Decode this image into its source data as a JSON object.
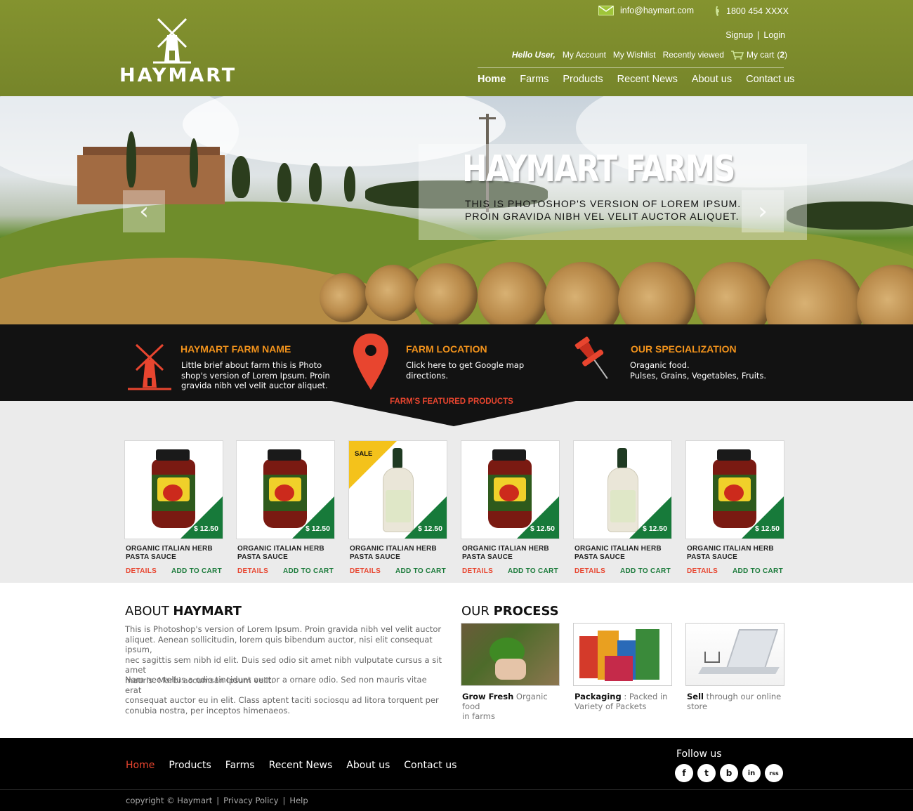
{
  "brand": {
    "name": "HAYMART"
  },
  "contact": {
    "email": "info@haymart.com",
    "phone": "1800 454 XXXX"
  },
  "auth": {
    "signup": "Signup",
    "separator": "|",
    "login": "Login"
  },
  "userbar": {
    "hello": "Hello User,",
    "my_account": "My Account",
    "my_wishlist": "My Wishlist",
    "recently_viewed": "Recently viewed",
    "cart_label": "My cart",
    "cart_count": "2"
  },
  "nav": [
    "Home",
    "Farms",
    "Products",
    "Recent News",
    "About us",
    "Contact us"
  ],
  "hero": {
    "title": "HAYMART FARMS",
    "subtitle_line1": "THIS IS PHOTOSHOP'S VERSION  OF LOREM IPSUM.",
    "subtitle_line2": "PROIN GRAVIDA NIBH VEL VELIT AUCTOR ALIQUET.",
    "prev": "‹",
    "next": "›"
  },
  "features": [
    {
      "title": "HAYMART FARM NAME",
      "line1": "Little brief about farm this is Photo",
      "line2": "shop's version  of Lorem Ipsum. Proin",
      "line3": "gravida nibh vel velit auctor aliquet."
    },
    {
      "title": "FARM LOCATION",
      "line1": "Click here to get Google map directions.",
      "line2": "",
      "line3": ""
    },
    {
      "title": "OUR SPECIALIZATION",
      "line1": "Oraganic food.",
      "line2": "Pulses, Grains, Vegetables, Fruits.",
      "line3": ""
    }
  ],
  "featured_label": "FARM'S FEATURED PRODUCTS",
  "products": [
    {
      "name1": "ORGANIC ITALIAN HERB",
      "name2": "PASTA SAUCE",
      "price": "$ 12.50",
      "sale": "",
      "details": "DETAILS",
      "add": "ADD TO CART"
    },
    {
      "name1": "ORGANIC ITALIAN HERB",
      "name2": "PASTA SAUCE",
      "price": "$ 12.50",
      "sale": "",
      "details": "DETAILS",
      "add": "ADD TO CART"
    },
    {
      "name1": "ORGANIC ITALIAN HERB",
      "name2": "PASTA SAUCE",
      "price": "$ 12.50",
      "sale": "SALE",
      "details": "DETAILS",
      "add": "ADD TO CART"
    },
    {
      "name1": "ORGANIC ITALIAN HERB",
      "name2": "PASTA SAUCE",
      "price": "$ 12.50",
      "sale": "",
      "details": "DETAILS",
      "add": "ADD TO CART"
    },
    {
      "name1": "ORGANIC ITALIAN HERB",
      "name2": "PASTA SAUCE",
      "price": "$ 12.50",
      "sale": "",
      "details": "DETAILS",
      "add": "ADD TO CART"
    },
    {
      "name1": "ORGANIC ITALIAN HERB",
      "name2": "PASTA SAUCE",
      "price": "$ 12.50",
      "sale": "",
      "details": "DETAILS",
      "add": "ADD TO CART"
    }
  ],
  "about": {
    "title_light": "ABOUT",
    "title_bold": "HAYMART",
    "p1": [
      "This is Photoshop's version  of Lorem Ipsum. Proin gravida nibh vel velit auctor",
      "aliquet. Aenean sollicitudin, lorem quis bibendum auctor, nisi elit consequat ipsum,",
      "nec sagittis sem nibh id elit. Duis sed odio sit amet nibh vulputate cursus a sit amet",
      "mauris. Morbi accumsan ipsum velit."
    ],
    "p2": [
      "Nam nec tellus a odio tincidunt auctor a ornare odio. Sed non  mauris vitae erat",
      "consequat auctor eu in elit. Class aptent taciti sociosqu ad litora torquent per",
      "conubia nostra, per inceptos himenaeos."
    ]
  },
  "process": {
    "title_light": "OUR",
    "title_bold": "PROCESS",
    "items": [
      {
        "bold": "Grow Fresh",
        "rest1": " Organic food",
        "rest2": "in farms"
      },
      {
        "bold": "Packaging",
        "rest1": " : Packed in",
        "rest2": "Variety of Packets"
      },
      {
        "bold": "Sell",
        "rest1": " through our online",
        "rest2": "store"
      }
    ]
  },
  "footer": {
    "nav": [
      "Home",
      "Products",
      "Farms",
      "Recent News",
      "About us",
      "Contact us"
    ],
    "follow": "Follow us",
    "socials": [
      "f",
      "t",
      "b",
      "in",
      "rss"
    ],
    "copyright": "copyright © Haymart",
    "privacy": "Privacy Policy",
    "help": "Help",
    "separator": "|"
  },
  "colors": {
    "header_green": "#7b8a2c",
    "accent_orange": "#f2931c",
    "accent_red": "#e8452f",
    "price_green": "#177a3a",
    "sale_yellow": "#f4c21b"
  }
}
